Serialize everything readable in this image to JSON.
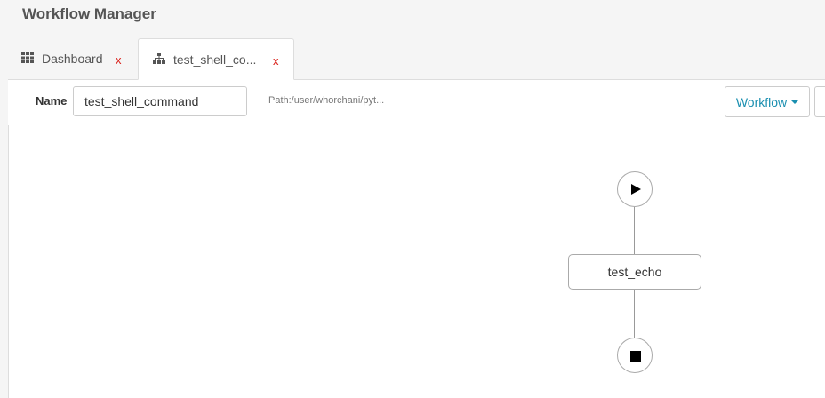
{
  "app": {
    "title": "Workflow Manager"
  },
  "tabs": [
    {
      "label": "Dashboard",
      "icon": "grid-icon",
      "close": "x"
    },
    {
      "label": "test_shell_co...",
      "icon": "sitemap-icon",
      "close": "x"
    }
  ],
  "toolbar": {
    "name_label": "Name",
    "name_value": "test_shell_command",
    "path": "Path:/user/whorchani/pyt...",
    "workflow_button": "Workflow"
  },
  "canvas": {
    "start_icon": "play-icon",
    "action_label": "test_echo",
    "end_icon": "stop-icon"
  },
  "colors": {
    "accent": "#1a8fb0",
    "close": "#d9201a"
  }
}
